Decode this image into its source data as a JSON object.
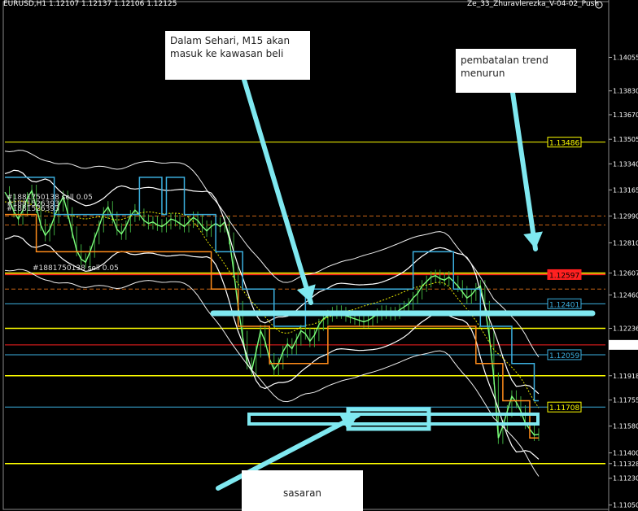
{
  "header": {
    "symbol_info": "EURUSD,H1  1.12107 1.12137 1.12106 1.12125",
    "expert": "Ze_33_Zhuravlerezka_V-04-02_Push"
  },
  "notes": {
    "entry": "Dalam Sehari, M15 akan masuk ke kawasan beli",
    "reversal": "pembatalan trend menurun",
    "target": "sasaran"
  },
  "order_labels": [
    "#1881750138 sell 0.05",
    "#1881750138 sell 0.05",
    "#1881526393",
    "#1881526393"
  ],
  "colors": {
    "background": "#000000",
    "candle": "#3ea83e",
    "yellow_level": "#ffff00",
    "cyan_level": "#3cb0e0",
    "orange": "#ff8c1a",
    "red": "#ff2020",
    "annotation": "#7fe8f0"
  },
  "chart_data": {
    "type": "line",
    "ylim": [
      1.1101,
      1.1444
    ],
    "x": [
      0,
      1,
      2,
      3,
      4,
      5,
      6,
      7,
      8,
      9,
      10,
      11,
      12,
      13,
      14,
      15,
      16,
      17,
      18,
      19,
      20,
      21,
      22,
      23,
      24,
      25,
      26,
      27,
      28,
      29,
      30,
      31,
      32,
      33,
      34,
      35,
      36,
      37,
      38,
      39,
      40,
      41,
      42,
      43,
      44,
      45,
      46,
      47,
      48,
      49,
      50,
      51,
      52,
      53,
      54,
      55,
      56,
      57,
      58,
      59,
      60,
      61,
      62,
      63,
      64,
      65,
      66,
      67,
      68,
      69,
      70,
      71,
      72,
      73,
      74,
      75,
      76,
      77,
      78,
      79,
      80,
      81,
      82,
      83,
      84,
      85,
      86,
      87,
      88,
      89,
      90,
      91,
      92,
      93,
      94,
      95,
      96,
      97,
      98,
      99,
      100,
      101,
      102,
      103,
      104,
      105,
      106,
      107,
      108,
      109,
      110,
      111,
      112,
      113,
      114,
      115,
      116,
      117,
      118,
      119
    ],
    "series": [
      {
        "values": [
          1.1315,
          1.131,
          1.1302,
          1.1297,
          1.1303,
          1.1311,
          1.1316,
          1.1305,
          1.1293,
          1.1286,
          1.129,
          1.1298,
          1.1306,
          1.1312,
          1.1301,
          1.1288,
          1.1276,
          1.127,
          1.1268,
          1.1275,
          1.1284,
          1.1292,
          1.1301,
          1.1305,
          1.1298,
          1.129,
          1.1287,
          1.1292,
          1.1299,
          1.1303,
          1.13,
          1.1296,
          1.1294,
          1.1295,
          1.1293,
          1.1292,
          1.1294,
          1.1297,
          1.1296,
          1.1294,
          1.1292,
          1.1295,
          1.1298,
          1.1296,
          1.1292,
          1.1289,
          1.1292,
          1.1294,
          1.1292,
          1.1295,
          1.1284,
          1.1262,
          1.1238,
          1.1218,
          1.12,
          1.1195,
          1.1208,
          1.1222,
          1.1215,
          1.1203,
          1.1196,
          1.12,
          1.1208,
          1.1213,
          1.121,
          1.1216,
          1.1222,
          1.122,
          1.1215,
          1.1219,
          1.1226,
          1.123,
          1.1232,
          1.1234,
          1.1235,
          1.1234,
          1.1232,
          1.1231,
          1.123,
          1.1229,
          1.1228,
          1.1229,
          1.1231,
          1.1233,
          1.1235,
          1.1234,
          1.1233,
          1.1234,
          1.1236,
          1.1238,
          1.124,
          1.1244,
          1.1247,
          1.1252,
          1.1255,
          1.1258,
          1.1259,
          1.1257,
          1.1256,
          1.1258,
          1.1255,
          1.1252,
          1.1248,
          1.1244,
          1.1246,
          1.125,
          1.1252,
          1.1238,
          1.1218,
          1.119,
          1.115,
          1.1158,
          1.1168,
          1.1178,
          1.1174,
          1.1168,
          1.116,
          1.1156,
          1.1152,
          1.11525
        ]
      }
    ],
    "levels": [
      1.13486,
      1.12597,
      1.12401,
      1.12059,
      1.11708
    ],
    "yticks": [
      1.14055,
      1.1383,
      1.1367,
      1.13505,
      1.1334,
      1.13165,
      1.1299,
      1.1281,
      1.12607,
      1.1246,
      1.12236,
      1.12125,
      1.11918,
      1.11755,
      1.1158,
      1.114,
      1.11328,
      1.1123,
      1.1105
    ],
    "tick_labels": [
      "1.14055",
      "1.13830",
      "1.13670",
      "1.13505",
      "1.13340",
      "1.13165",
      "1.12990",
      "1.12810",
      "1.12607",
      "1.12460",
      "1.12236",
      "1.12125",
      "1.11918",
      "1.11755",
      "1.11580",
      "1.11400",
      "1.11328",
      "1.11230",
      "1.11050"
    ],
    "level_labels": [
      "1.13486",
      "1.12597",
      "1.12401",
      "1.12059",
      "1.11708"
    ]
  }
}
